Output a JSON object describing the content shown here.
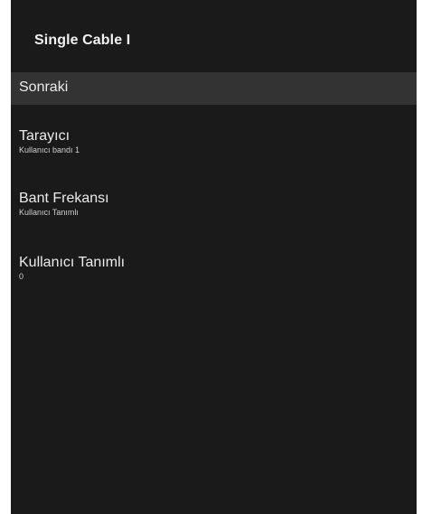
{
  "panel": {
    "title": "Single Cable I"
  },
  "menu": {
    "items": [
      {
        "label": "Sonraki",
        "sub": ""
      },
      {
        "label": "Tarayıcı",
        "sub": "Kullanıcı bandı 1"
      },
      {
        "label": "Bant Frekansı",
        "sub": "Kullanıcı Tanımlı"
      },
      {
        "label": "Kullanıcı Tanımlı",
        "sub": "0"
      }
    ],
    "selected_index": 0
  },
  "colors": {
    "panel_background": "#1a1a1a",
    "selected_row": "#333333",
    "text": "#ececec"
  }
}
